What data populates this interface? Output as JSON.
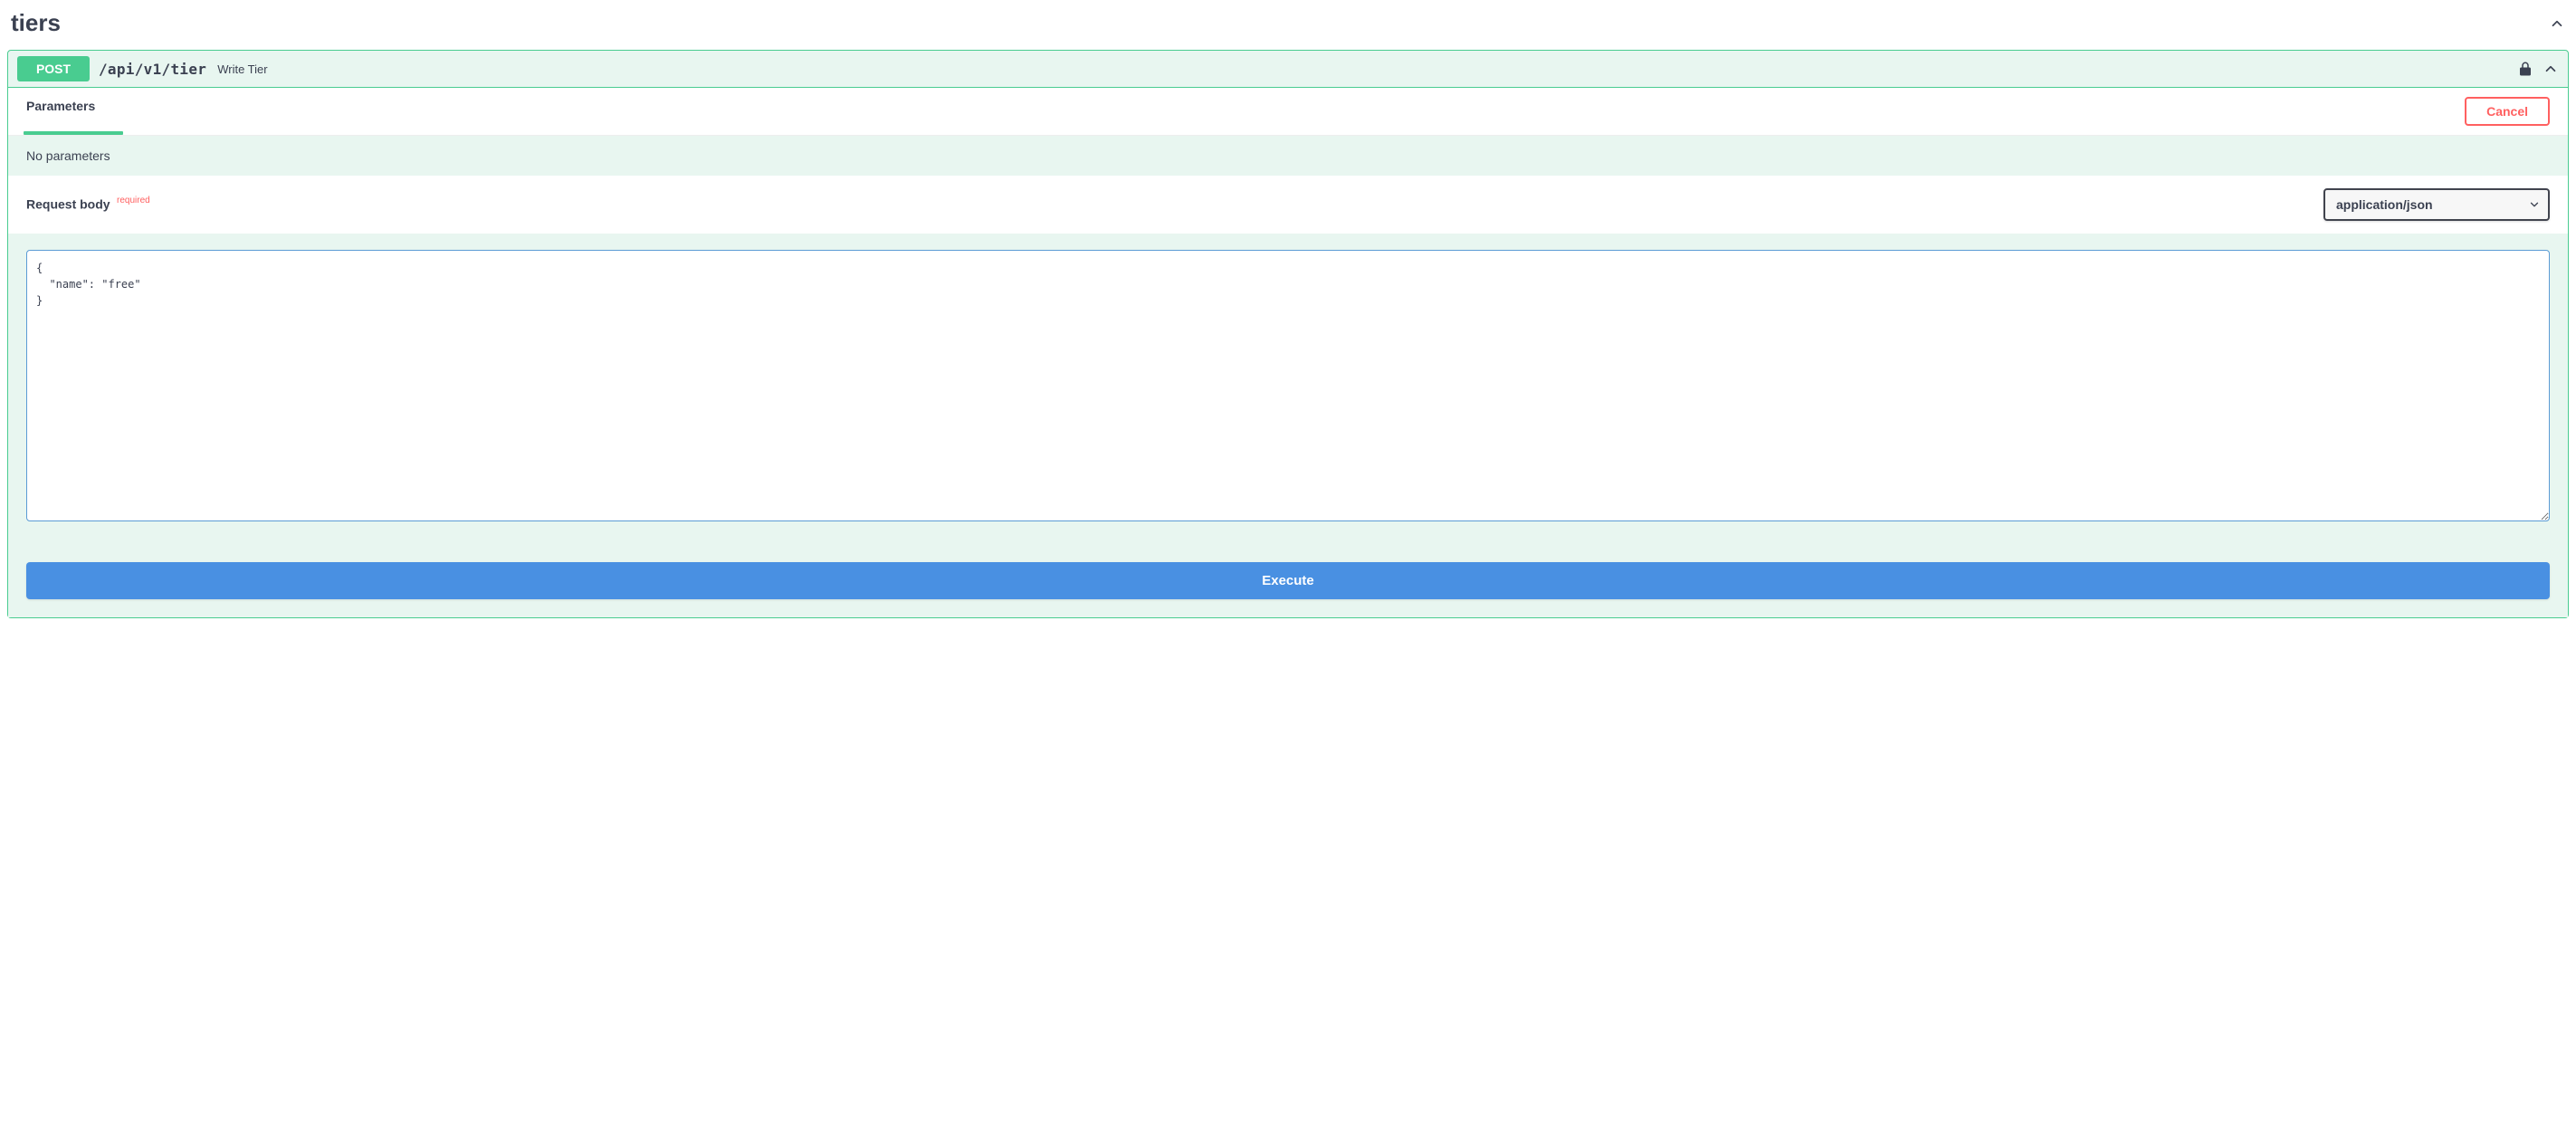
{
  "section": {
    "title": "tiers"
  },
  "endpoint": {
    "method": "POST",
    "path": "/api/v1/tier",
    "summary": "Write Tier"
  },
  "tabs": {
    "parameters": "Parameters"
  },
  "buttons": {
    "cancel": "Cancel",
    "execute": "Execute"
  },
  "parameters": {
    "empty_message": "No parameters"
  },
  "request_body": {
    "label": "Request body",
    "required_tag": "required",
    "content_type_options": [
      "application/json"
    ],
    "content_type_selected": "application/json",
    "value": "{\n  \"name\": \"free\"\n}"
  }
}
